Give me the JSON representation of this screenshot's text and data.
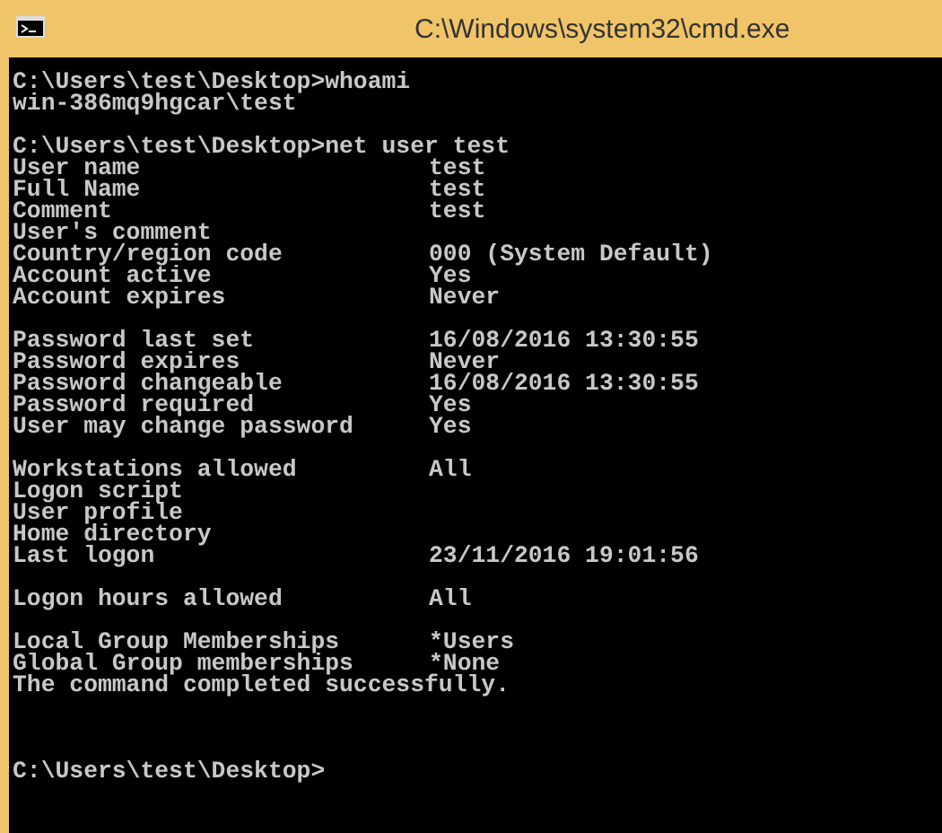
{
  "window": {
    "title": "C:\\Windows\\system32\\cmd.exe"
  },
  "console": {
    "blocks": [
      {
        "lines": [
          {
            "kind": "text",
            "text": "C:\\Users\\test\\Desktop>whoami"
          },
          {
            "kind": "text",
            "text": "win-386mq9hgcar\\test"
          }
        ]
      },
      {
        "lines": [
          {
            "kind": "text",
            "text": "C:\\Users\\test\\Desktop>net user test"
          },
          {
            "kind": "field",
            "label": "User name",
            "value": "test"
          },
          {
            "kind": "field",
            "label": "Full Name",
            "value": "test"
          },
          {
            "kind": "field",
            "label": "Comment",
            "value": "test"
          },
          {
            "kind": "field",
            "label": "User's comment"
          },
          {
            "kind": "field",
            "label": "Country/region code",
            "value": "000 (System Default)"
          },
          {
            "kind": "field",
            "label": "Account active",
            "value": "Yes"
          },
          {
            "kind": "field",
            "label": "Account expires",
            "value": "Never"
          }
        ]
      },
      {
        "lines": [
          {
            "kind": "field",
            "label": "Password last set",
            "value": "16/08/2016 13:30:55"
          },
          {
            "kind": "field",
            "label": "Password expires",
            "value": "Never"
          },
          {
            "kind": "field",
            "label": "Password changeable",
            "value": "16/08/2016 13:30:55"
          },
          {
            "kind": "field",
            "label": "Password required",
            "value": "Yes"
          },
          {
            "kind": "field",
            "label": "User may change password",
            "value": "Yes"
          }
        ]
      },
      {
        "lines": [
          {
            "kind": "field",
            "label": "Workstations allowed",
            "value": "All"
          },
          {
            "kind": "field",
            "label": "Logon script"
          },
          {
            "kind": "field",
            "label": "User profile"
          },
          {
            "kind": "field",
            "label": "Home directory"
          },
          {
            "kind": "field",
            "label": "Last logon",
            "value": "23/11/2016 19:01:56"
          }
        ]
      },
      {
        "lines": [
          {
            "kind": "field",
            "label": "Logon hours allowed",
            "value": "All"
          }
        ]
      },
      {
        "lines": [
          {
            "kind": "field",
            "label": "Local Group Memberships",
            "value": "*Users"
          },
          {
            "kind": "field",
            "label": "Global Group memberships",
            "value": "*None"
          },
          {
            "kind": "text",
            "text": "The command completed successfully."
          }
        ]
      },
      {
        "lines": [
          {
            "kind": "text",
            "text": "C:\\Users\\test\\Desktop>"
          }
        ]
      }
    ]
  }
}
